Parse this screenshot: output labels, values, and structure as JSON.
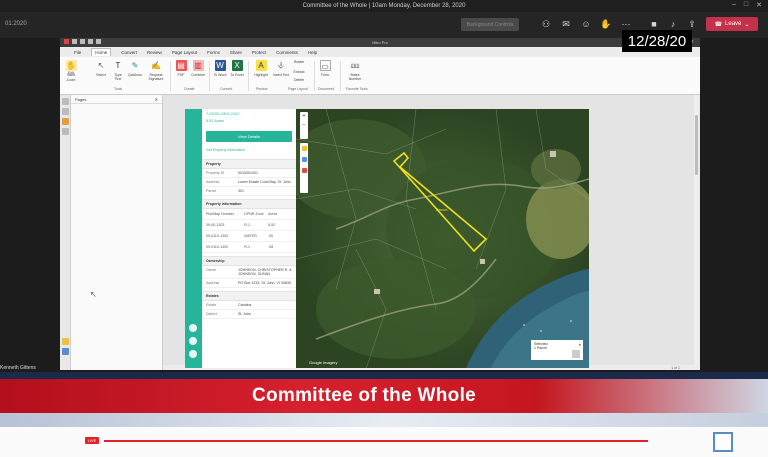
{
  "meeting": {
    "title": "Committee of the Whole | 10am Monday, December 28, 2020",
    "elapsed": "01:2020",
    "participants_btn": "Background Controls",
    "leave_label": "Leave"
  },
  "date_overlay": "12/28/20",
  "pdf_app": {
    "title": "Nitro Pro",
    "tabs": [
      "File",
      "Home",
      "Convert",
      "Review",
      "Page Layout",
      "Forms",
      "Share",
      "Protect",
      "Comments",
      "Help"
    ],
    "active_tab": "Home",
    "ribbon_buttons": [
      "Hand",
      "Edit",
      "Zoom",
      "Select",
      "Type Text",
      "Quickrun",
      "Request Signature",
      "PDF",
      "Combine",
      "To Word",
      "To Excel",
      "Highlight",
      "Insert Text",
      "Rotate",
      "Extract",
      "Delete",
      "Form",
      "Bates Number"
    ],
    "ribbon_groups": [
      "Tools",
      "Create",
      "Convert",
      "Review",
      "Page Layout",
      "Document",
      "Favorite Tools"
    ],
    "panel_title": "Pages",
    "bottom_page": "1 of 1"
  },
  "property_panel": {
    "parcel_id": "7-01001-0301-0101",
    "acreage": "5.52 Acres",
    "view_details": "View Details",
    "link": "Get Property Information",
    "sections": {
      "property": "Property",
      "property_info": "Property Information",
      "ownership": "Ownership",
      "estates": "Estates"
    },
    "rows": [
      {
        "label": "Property ID",
        "value": "0015301001"
      },
      {
        "label": "Address",
        "value": "Lower Estate Coral Bay, St. John"
      },
      {
        "label": "Parcel",
        "value": "301"
      }
    ],
    "table_head": [
      "Plot/Map Number",
      "DPNR Zone",
      "Acres"
    ],
    "table_rows": [
      [
        "09-00-1303",
        "R-1",
        "5.52"
      ],
      [
        "09-0110-1300",
        "WATER",
        ".00"
      ],
      [
        "09-0110-1300",
        "R-1",
        ".08"
      ]
    ],
    "ownership_rows": [
      {
        "label": "Owner",
        "value": "JOHNSON, CHRISTOPHER R. & JOHNSON, SUSAN"
      },
      {
        "label": "Address",
        "value": "PO Box 1234, St. John, VI 00830"
      }
    ],
    "estate_rows": [
      {
        "label": "Estate",
        "value": "Carolina"
      },
      {
        "label": "District",
        "value": "St. John"
      }
    ]
  },
  "map": {
    "zoom_in": "+",
    "zoom_out": "−",
    "parcel_label": "Parcel",
    "attribution": "Google  Imagery",
    "info_box": {
      "title": "Selected",
      "subtitle": "1 Parcel",
      "close": "×"
    }
  },
  "lower_third": {
    "title": "Committee of the Whole",
    "live": "LIVE"
  },
  "presenter": "Kenneth Gittens"
}
